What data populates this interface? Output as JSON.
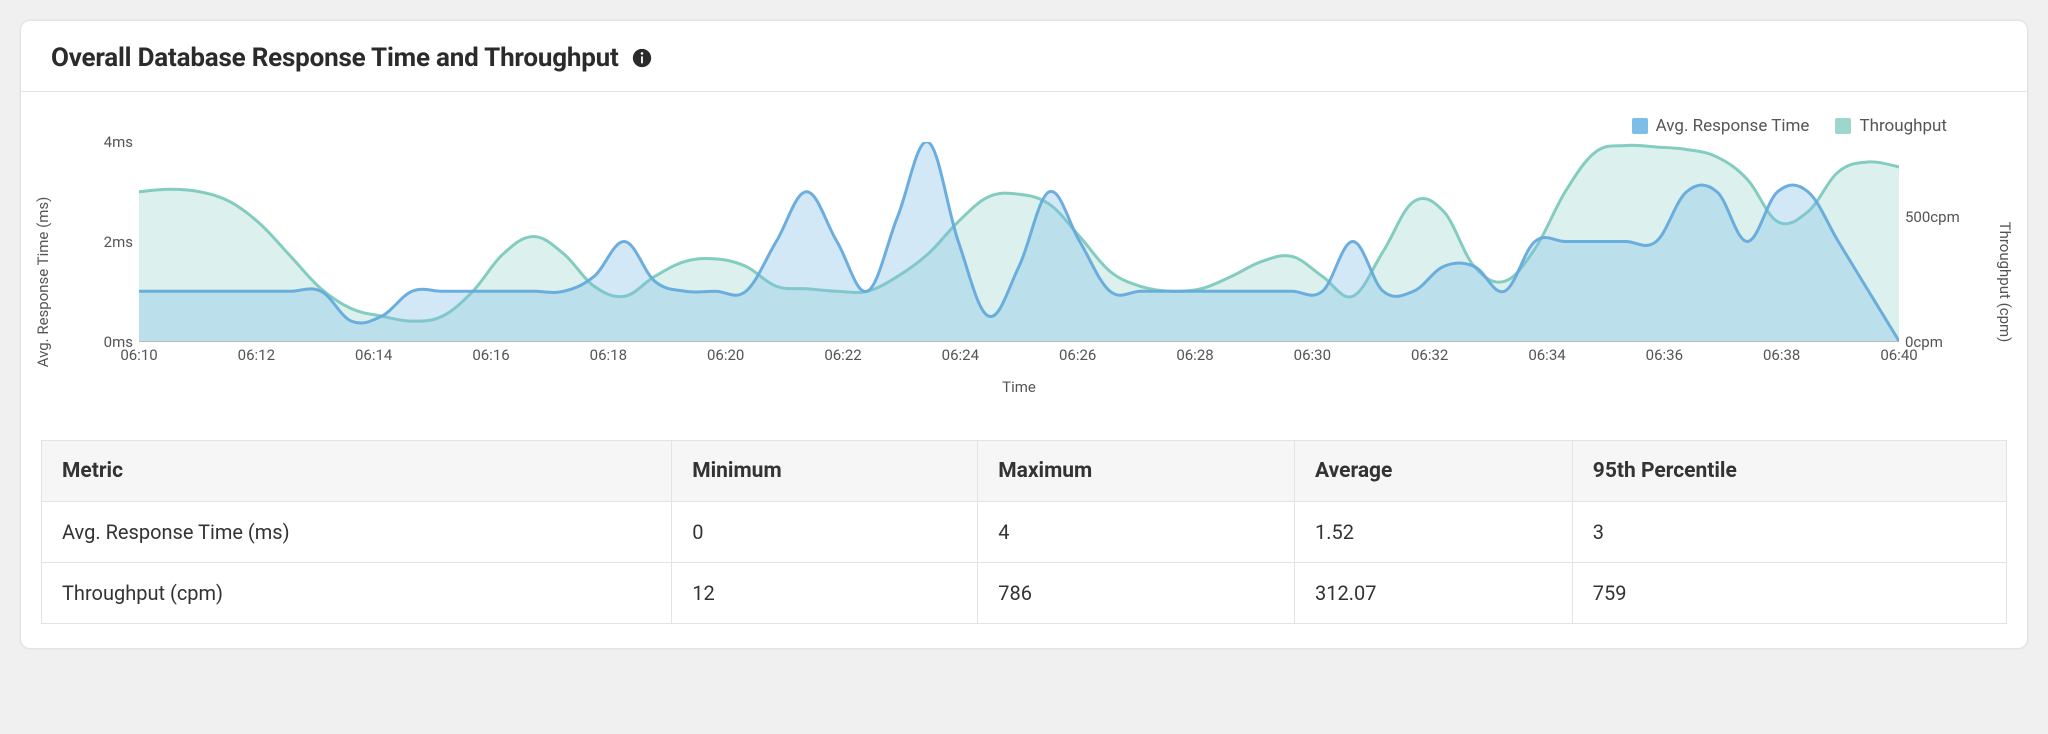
{
  "panel": {
    "title": "Overall Database Response Time and Throughput"
  },
  "legend": {
    "series1": "Avg. Response Time",
    "series2": "Throughput"
  },
  "axes": {
    "left_title": "Avg. Response Time (ms)",
    "right_title": "Throughput (cpm)",
    "x_title": "Time",
    "left_ticks": [
      "0ms",
      "2ms",
      "4ms"
    ],
    "right_ticks": [
      "0cpm",
      "500cpm"
    ],
    "x_ticks": [
      "06:10",
      "06:12",
      "06:14",
      "06:16",
      "06:18",
      "06:20",
      "06:22",
      "06:24",
      "06:26",
      "06:28",
      "06:30",
      "06:32",
      "06:34",
      "06:36",
      "06:38",
      "06:40"
    ]
  },
  "table": {
    "headers": [
      "Metric",
      "Minimum",
      "Maximum",
      "Average",
      "95th Percentile"
    ],
    "rows": [
      {
        "metric": "Avg. Response Time (ms)",
        "min": "0",
        "max": "4",
        "avg": "1.52",
        "p95": "3"
      },
      {
        "metric": "Throughput (cpm)",
        "min": "12",
        "max": "786",
        "avg": "312.07",
        "p95": "759"
      }
    ]
  },
  "chart_data": {
    "type": "area",
    "x_label": "Time",
    "x": [
      "06:10",
      "06:10.5",
      "06:11",
      "06:11.5",
      "06:12",
      "06:12.5",
      "06:13",
      "06:13.5",
      "06:14",
      "06:14.5",
      "06:15",
      "06:15.5",
      "06:16",
      "06:16.5",
      "06:17",
      "06:17.5",
      "06:18",
      "06:18.5",
      "06:19",
      "06:19.5",
      "06:20",
      "06:20.5",
      "06:21",
      "06:21.5",
      "06:22",
      "06:22.5",
      "06:23",
      "06:23.5",
      "06:24",
      "06:24.5",
      "06:25",
      "06:25.5",
      "06:26",
      "06:26.5",
      "06:27",
      "06:27.5",
      "06:28",
      "06:28.5",
      "06:29",
      "06:29.5",
      "06:30",
      "06:30.5",
      "06:31",
      "06:31.5",
      "06:32",
      "06:32.5",
      "06:33",
      "06:33.5",
      "06:34",
      "06:34.5",
      "06:35",
      "06:35.5",
      "06:36",
      "06:36.5",
      "06:37",
      "06:37.5",
      "06:38",
      "06:38.5",
      "06:39"
    ],
    "series": [
      {
        "name": "Avg. Response Time",
        "unit": "ms",
        "y_axis": "left",
        "ylim": [
          0,
          4
        ],
        "color": "#7fbde9",
        "values": [
          1.0,
          1.0,
          1.0,
          1.0,
          1.0,
          1.0,
          1.0,
          0.4,
          0.5,
          1.0,
          1.0,
          1.0,
          1.0,
          1.0,
          1.0,
          1.3,
          2.0,
          1.2,
          1.0,
          1.0,
          1.0,
          2.0,
          3.0,
          2.0,
          1.0,
          2.5,
          4.0,
          2.0,
          0.5,
          1.5,
          3.0,
          2.0,
          1.0,
          1.0,
          1.0,
          1.0,
          1.0,
          1.0,
          1.0,
          1.0,
          2.0,
          1.0,
          1.0,
          1.5,
          1.5,
          1.0,
          2.0,
          2.0,
          2.0,
          2.0,
          2.0,
          3.0,
          3.0,
          2.0,
          3.0,
          3.0,
          2.0,
          1.0,
          0.0
        ]
      },
      {
        "name": "Throughput",
        "unit": "cpm",
        "y_axis": "right",
        "ylim": [
          0,
          800
        ],
        "color": "#9cd6cc",
        "values": [
          600,
          610,
          600,
          560,
          470,
          340,
          210,
          130,
          100,
          80,
          100,
          200,
          350,
          420,
          350,
          220,
          180,
          260,
          320,
          330,
          300,
          220,
          210,
          200,
          200,
          260,
          350,
          480,
          580,
          590,
          550,
          420,
          280,
          220,
          200,
          210,
          260,
          320,
          340,
          260,
          180,
          360,
          560,
          520,
          300,
          240,
          370,
          600,
          760,
          786,
          780,
          770,
          740,
          650,
          480,
          520,
          680,
          720,
          700
        ]
      }
    ]
  }
}
